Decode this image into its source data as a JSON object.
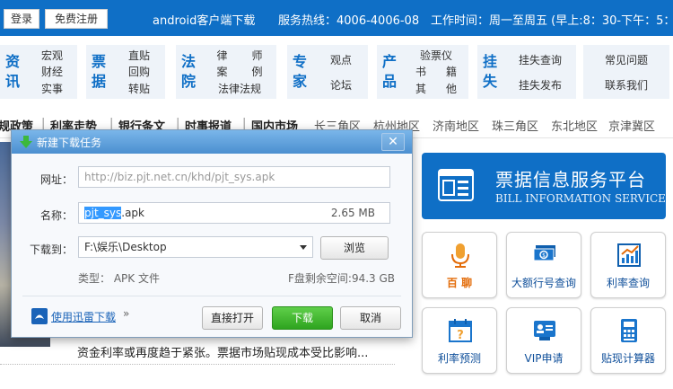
{
  "topbar": {
    "login": "登录",
    "register": "免费注册",
    "android": "android客户端下载",
    "hotline": "服务热线：4006-4006-08",
    "hours": "工作时间：周一至周五 (早上:8：30-下午：5：30)"
  },
  "categories": [
    {
      "title": [
        "资",
        "讯"
      ],
      "links": [
        "宏观",
        "财经",
        "实事"
      ]
    },
    {
      "title": [
        "票",
        "据"
      ],
      "links": [
        "直贴",
        "回购",
        "转贴"
      ]
    },
    {
      "title": [
        "法",
        "院"
      ],
      "links": [
        "律",
        "师",
        "案",
        "例",
        "法律法规"
      ]
    },
    {
      "title": [
        "专",
        "家"
      ],
      "links": [
        "观点",
        "论坛"
      ]
    },
    {
      "title": [
        "产",
        "品"
      ],
      "links": [
        "验票仪",
        "书",
        "籍",
        "其",
        "他"
      ]
    },
    {
      "title": [
        "挂",
        "失"
      ],
      "links": [
        "挂失查询",
        "挂失发布"
      ]
    },
    {
      "title": [],
      "links": [
        "常见问题",
        "联系我们"
      ]
    }
  ],
  "subnav": {
    "bold": [
      "规政策",
      "利率走势",
      "银行条文",
      "时事报道",
      "国内市场"
    ],
    "light": [
      "长三角区",
      "杭州地区",
      "济南地区",
      "珠三角区",
      "东北地区",
      "京津冀区"
    ]
  },
  "banner": {
    "title": "票据信息服务平台",
    "subtitle": "BILL INFORMATION SERVICE"
  },
  "tiles": [
    {
      "label": "百 聊",
      "icon": "microphone-icon"
    },
    {
      "label": "大额行号查询",
      "icon": "money-icon"
    },
    {
      "label": "利率查询",
      "icon": "chart-icon"
    },
    {
      "label": "利率预测",
      "icon": "calendar-question-icon"
    },
    {
      "label": "VIP申请",
      "icon": "vip-card-icon"
    },
    {
      "label": "贴现计算器",
      "icon": "calculator-icon"
    }
  ],
  "dialog": {
    "title": "新建下载任务",
    "close": "✕",
    "url_label": "网址：",
    "url_value": "http://biz.pjt.net.cn/khd/pjt_sys.apk",
    "name_label": "名称：",
    "name_selected": "pjt_sys",
    "name_rest": ".apk",
    "size": "2.65 MB",
    "saveto_label": "下载到：",
    "saveto_value": "F:\\娱乐\\Desktop",
    "browse": "浏览",
    "type_info": "类型： APK 文件",
    "space_info": "F盘剩余空间:94.3 GB",
    "thunder_link": "使用迅雷下载",
    "open_direct": "直接打开",
    "download": "下载",
    "cancel": "取消"
  },
  "bottom_text": "资金利率或再度趋于紧张。票据市场贴现成本受比影响..."
}
